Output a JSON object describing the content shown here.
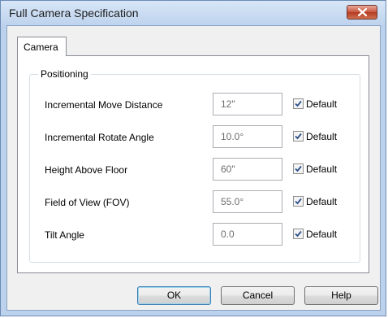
{
  "window": {
    "title": "Full Camera Specification"
  },
  "tabs": [
    {
      "label": "Camera",
      "active": true
    }
  ],
  "positioning": {
    "group_label": "Positioning",
    "default_label": "Default",
    "rows": [
      {
        "label": "Incremental Move Distance",
        "value": "12\"",
        "default_checked": true
      },
      {
        "label": "Incremental Rotate Angle",
        "value": "10.0°",
        "default_checked": true
      },
      {
        "label": "Height Above Floor",
        "value": "60\"",
        "default_checked": true
      },
      {
        "label": "Field of View (FOV)",
        "value": "55.0°",
        "default_checked": true
      },
      {
        "label": "Tilt Angle",
        "value": "0.0",
        "default_checked": true
      }
    ]
  },
  "buttons": {
    "ok": "OK",
    "cancel": "Cancel",
    "help": "Help"
  }
}
